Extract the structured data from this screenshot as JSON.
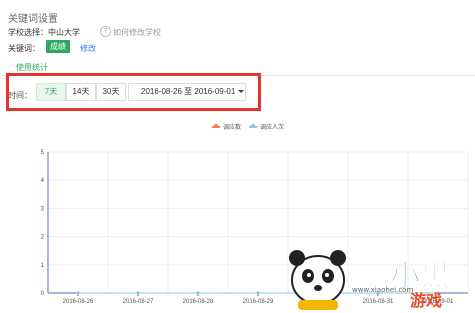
{
  "header": {
    "title": "关键词设置",
    "school_label": "学校选择：",
    "school_value": "中山大学",
    "help_link": "如何修改学校",
    "keyword_label": "关键词：",
    "keyword_tag": "成绩",
    "edit_link": "修改"
  },
  "tabs": [
    {
      "label": "使用统计",
      "active": true
    }
  ],
  "filter": {
    "time_label": "时间：",
    "ranges": [
      "7天",
      "14天",
      "30天"
    ],
    "selected_range": "7天",
    "date_range": "2016-08-26 至 2016-09-01"
  },
  "chart_data": {
    "type": "line",
    "categories": [
      "2016-08-26",
      "2016-08-27",
      "2016-08-28",
      "2016-08-29",
      "2016-08-30",
      "2016-08-31",
      "2016-09-01"
    ],
    "series": [
      {
        "name": "调应数",
        "values": [
          0,
          0,
          0,
          0,
          0,
          0,
          0
        ],
        "color": "#ef7b4e"
      },
      {
        "name": "调应人次",
        "values": [
          0,
          0,
          0,
          0,
          0,
          0,
          0
        ],
        "color": "#8ec6e6"
      }
    ],
    "yticks": [
      0,
      1,
      2,
      3,
      4,
      5
    ],
    "ylim": [
      0,
      5
    ],
    "grid": true,
    "legend_position": "top-center"
  },
  "watermark": {
    "text": "小黑游戏",
    "url": "www.xiaohei.com"
  },
  "colors": {
    "accent": "#2eaa5f",
    "highlight_box": "#e5322d",
    "link": "#3a7bd5"
  }
}
